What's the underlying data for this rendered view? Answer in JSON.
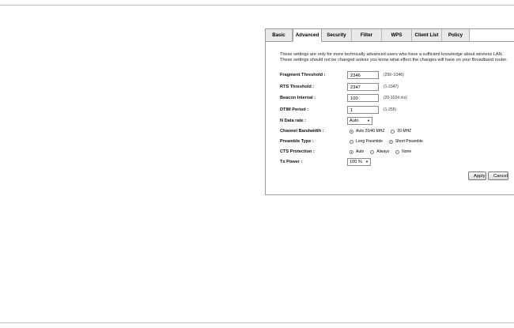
{
  "tabs": [
    {
      "label": "Basic"
    },
    {
      "label": "Advanced"
    },
    {
      "label": "Security"
    },
    {
      "label": "Filter"
    },
    {
      "label": "WPS"
    },
    {
      "label": "Client List"
    },
    {
      "label": "Policy"
    }
  ],
  "active_tab": "Advanced",
  "description": "These settings are only for more technically advanced users who have a sufficient knowledge about wireless LAN. These settings should not be changed unless you know what effect the changes will have on your Broadband router.",
  "fields": {
    "fragment": {
      "label": "Fragment Threshold :",
      "value": "2346",
      "hint": "(256~2346)"
    },
    "rts": {
      "label": "RTS Threshold :",
      "value": "2347",
      "hint": "(1-2347)"
    },
    "beacon": {
      "label": "Beacon Interval :",
      "value": "100",
      "hint": "(20-1024 ms)"
    },
    "dtim": {
      "label": "DTIM Period :",
      "value": "1",
      "hint": "(1-255)"
    },
    "ndata": {
      "label": "N Data rate :",
      "value": "Auto"
    },
    "bandwidth": {
      "label": "Channel Bandwidth :",
      "options": [
        "Auto 20/40 MHZ",
        "20 MHZ"
      ],
      "selected": "Auto 20/40 MHZ"
    },
    "preamble": {
      "label": "Preamble Type :",
      "options": [
        "Long Preamble",
        "Short Preamble"
      ],
      "selected": "Short Preamble"
    },
    "cts": {
      "label": "CTS Protection :",
      "options": [
        "Auto",
        "Always",
        "None"
      ],
      "selected": "Auto"
    },
    "txpower": {
      "label": "Tx Power :",
      "value": "100 %"
    }
  },
  "buttons": {
    "apply": "Apply",
    "cancel": "Cancel"
  }
}
